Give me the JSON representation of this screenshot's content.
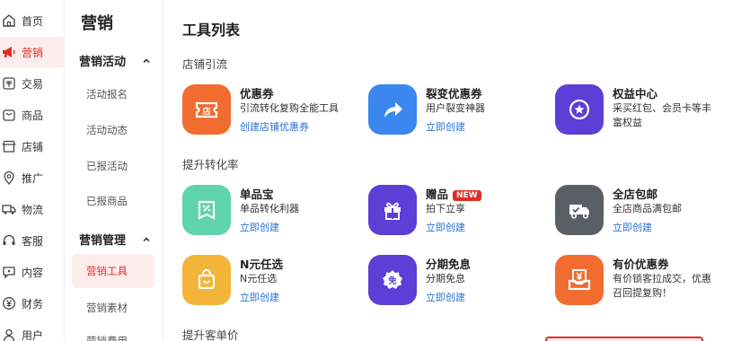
{
  "nav": {
    "items": [
      {
        "label": "首页",
        "icon": "home-icon"
      },
      {
        "label": "营销",
        "icon": "megaphone-icon"
      },
      {
        "label": "交易",
        "icon": "transaction-icon"
      },
      {
        "label": "商品",
        "icon": "bag-icon"
      },
      {
        "label": "店铺",
        "icon": "store-icon"
      },
      {
        "label": "推广",
        "icon": "location-pin-icon"
      },
      {
        "label": "物流",
        "icon": "truck-icon"
      },
      {
        "label": "客服",
        "icon": "headset-icon"
      },
      {
        "label": "内容",
        "icon": "chat-icon"
      },
      {
        "label": "财务",
        "icon": "yuan-icon"
      },
      {
        "label": "用户",
        "icon": "user-icon"
      }
    ],
    "active_color": "#e02e24"
  },
  "submenu": {
    "title": "营销",
    "groups": [
      {
        "label": "营销活动",
        "items": [
          "活动报名",
          "活动动态",
          "已报活动",
          "已报商品"
        ]
      },
      {
        "label": "营销管理",
        "items": [
          "营销工具",
          "营销素材",
          "营销费用"
        ]
      }
    ]
  },
  "main": {
    "title": "工具列表",
    "sections": [
      {
        "title": "店铺引流",
        "tools": [
          {
            "name": "优惠券",
            "desc": "引流转化复购全能工具",
            "link": "创建店铺优惠券",
            "color": "#f26b2f",
            "icon": "coupon-icon"
          },
          {
            "name": "裂变优惠券",
            "desc": "用户裂变神器",
            "link": "立即创建",
            "color": "#3b87f0",
            "icon": "share-arrow-icon"
          },
          {
            "name": "权益中心",
            "desc": "采买红包、会员卡等丰富权益",
            "link": "",
            "color": "#5b3fd6",
            "icon": "star-badge-icon"
          }
        ]
      },
      {
        "title": "提升转化率",
        "tools": [
          {
            "name": "单品宝",
            "desc": "单品转化利器",
            "link": "立即创建",
            "color": "#5fd3a9",
            "icon": "percent-tag-icon"
          },
          {
            "name": "赠品",
            "badge": "NEW",
            "desc": "拍下立享",
            "link": "立即创建",
            "color": "#5b3fd6",
            "icon": "gift-icon"
          },
          {
            "name": "全店包邮",
            "desc": "全店商品满包邮",
            "link": "立即创建",
            "color": "#5a5f66",
            "icon": "delivery-truck-icon"
          }
        ]
      },
      {
        "title": "",
        "tools": [
          {
            "name": "N元任选",
            "desc": "N元任选",
            "link": "立即创建",
            "color": "#f2b53a",
            "icon": "shopping-bag-icon"
          },
          {
            "name": "分期免息",
            "desc": "分期免息",
            "link": "立即创建",
            "color": "#5b3fd6",
            "icon": "interest-free-icon"
          },
          {
            "name": "有价优惠券",
            "desc": "有价锁客拉成交，优惠召回提复购！",
            "link": "",
            "color": "#f26b2f",
            "icon": "voucher-yuan-icon"
          }
        ]
      },
      {
        "title": "提升客单价",
        "tools": []
      }
    ],
    "gift_icon_text": "免"
  }
}
